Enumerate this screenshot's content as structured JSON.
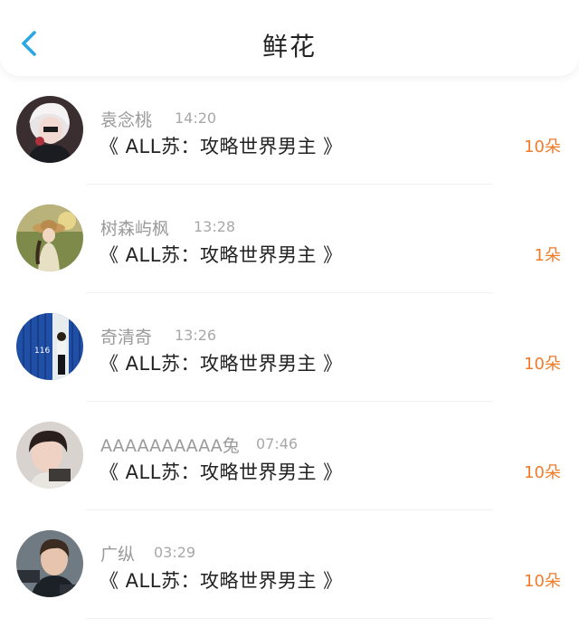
{
  "header": {
    "title": "鲜花",
    "back_icon": "chevron-left-icon",
    "accent": "#2aa7e6"
  },
  "colors": {
    "count": "#f07c2a",
    "name": "#9a9a9a",
    "book": "#222222"
  },
  "rows": [
    {
      "name": "袁念桃",
      "time": "14:20",
      "book": "《 ALL苏：攻略世界男主 》",
      "count": "10朵"
    },
    {
      "name": "树森屿枫",
      "time": "13:28",
      "book": "《 ALL苏：攻略世界男主 》",
      "count": "1朵"
    },
    {
      "name": "奇清奇",
      "time": "13:26",
      "book": "《 ALL苏：攻略世界男主 》",
      "count": "10朵"
    },
    {
      "name": "AAAAAAAAAA兔",
      "time": "07:46",
      "book": "《 ALL苏：攻略世界男主 》",
      "count": "10朵"
    },
    {
      "name": "广纵",
      "time": "03:29",
      "book": "《 ALL苏：攻略世界男主 》",
      "count": "10朵"
    }
  ]
}
